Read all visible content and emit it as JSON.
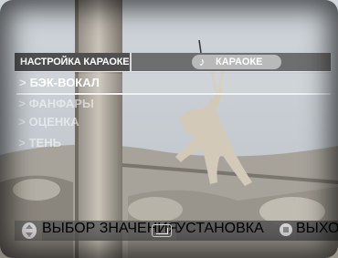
{
  "header": {
    "title": "НАСТРОЙКА КАРАОКЕ",
    "mode_label": "КАРАОКЕ",
    "mode_icon": "music-note-icon"
  },
  "menu": {
    "items": [
      {
        "label": "БЭК-ВОКАЛ",
        "selected": true
      },
      {
        "label": "ФАНФАРЫ",
        "selected": false
      },
      {
        "label": "ОЦЕНКА",
        "selected": false
      },
      {
        "label": "ТЕНЬ",
        "selected": false
      }
    ],
    "arrow": ">"
  },
  "footer": {
    "select_label": "ВЫБОР ЗНАЧЕНИЯ",
    "set_label": "УСТАНОВКА",
    "exit_label": "ВЫХОД"
  },
  "colors": {
    "header_title_bg": "#4f4f4f",
    "header_bar_bg": "#6e6e6e",
    "text": "#ffffff",
    "dim_text": "rgba(255,255,255,0.55)"
  }
}
